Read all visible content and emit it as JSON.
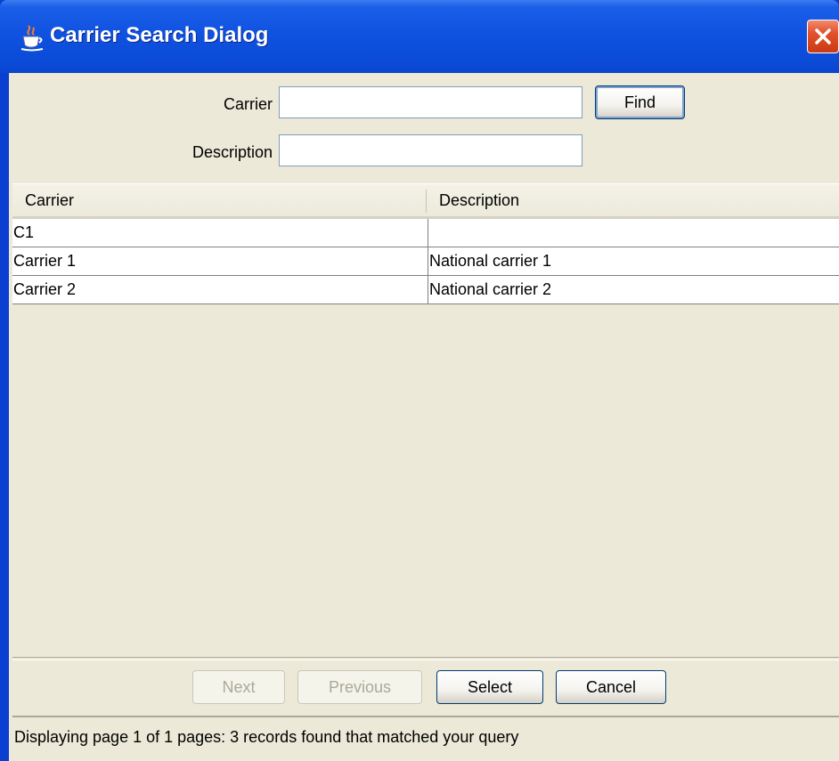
{
  "window": {
    "title": "Carrier Search Dialog",
    "icon": "java-cup-icon",
    "close_icon": "close-icon"
  },
  "form": {
    "carrier_label": "Carrier",
    "carrier_value": "",
    "description_label": "Description",
    "description_value": "",
    "find_label": "Find"
  },
  "table": {
    "columns": [
      "Carrier",
      "Description"
    ],
    "rows": [
      [
        "C1",
        ""
      ],
      [
        "Carrier 1",
        "National carrier 1"
      ],
      [
        "Carrier 2",
        "National carrier 2"
      ]
    ]
  },
  "buttons": {
    "next": "Next",
    "previous": "Previous",
    "select": "Select",
    "cancel": "Cancel"
  },
  "status": {
    "text": "Displaying page 1 of 1 pages:   3 records found that matched your query"
  },
  "colors": {
    "titlebar": "#0b49d6",
    "client_bg": "#ece9d8",
    "close_button": "#e2512c"
  }
}
